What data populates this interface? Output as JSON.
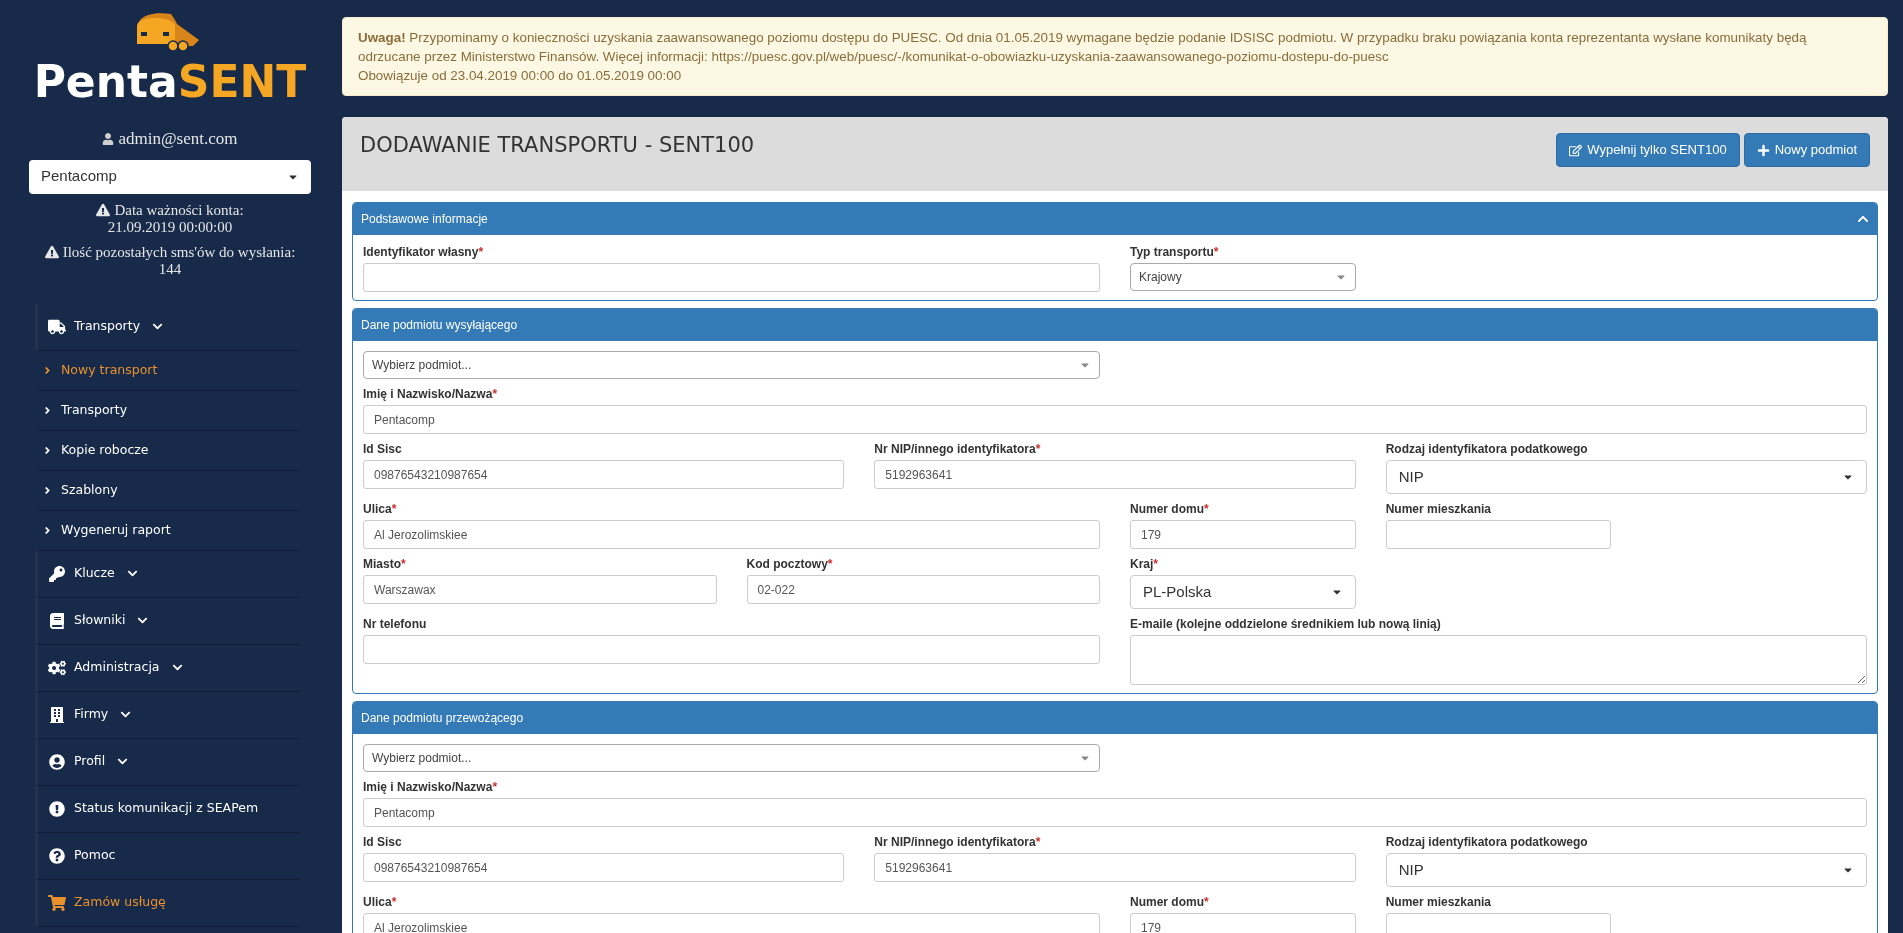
{
  "sidebar": {
    "logo": {
      "part_1": "Penta",
      "part_2": "SENT"
    },
    "user": "admin@sent.com",
    "company_select": {
      "value": "Pentacomp"
    },
    "notices": [
      {
        "label": "Data ważności konta:",
        "value": "21.09.2019 00:00:00"
      },
      {
        "label": "Ilość pozostałych sms'ów do wysłania:",
        "value": "144"
      }
    ],
    "menu": [
      {
        "kind": "group",
        "label": "Transporty",
        "children": [
          {
            "label": "Nowy transport",
            "selected": true
          },
          {
            "label": "Transporty",
            "selected": false
          },
          {
            "label": "Kopie robocze",
            "selected": false
          },
          {
            "label": "Szablony",
            "selected": false
          },
          {
            "label": "Wygeneruj raport",
            "selected": false
          }
        ]
      },
      {
        "kind": "group",
        "label": "Klucze"
      },
      {
        "kind": "group",
        "label": "Słowniki"
      },
      {
        "kind": "group",
        "label": "Administracja"
      },
      {
        "kind": "group",
        "label": "Firmy"
      },
      {
        "kind": "group",
        "label": "Profil"
      },
      {
        "kind": "link",
        "label": "Status komunikacji z SEAPem"
      },
      {
        "kind": "link",
        "label": "Pomoc"
      },
      {
        "kind": "promo",
        "label": "Zamów usługę"
      }
    ]
  },
  "alert": {
    "message": "**Uwaga!** Przypominamy o konieczności uzyskania zaawansowanego poziomu dostępu do PUESC. Od dnia 01.05.2019 wymagane będzie podanie IDSISC podmiotu. W przypadku braku powiązania konta reprezentanta wysłane komunikaty będą odrzucane przez Ministerstwo Finansów. Więcej informacji: https://puesc.gov.pl/web/puesc/-/komunikat-o-obowiazku-uzyskania-zaawansowanego-poziomu-dostepu-do-puesc",
    "validity": "Obowiązuje od 23.04.2019 00:00 do 01.05.2019 00:00"
  },
  "page": {
    "title": "DODAWANIE TRANSPORTU - SENT100",
    "buttons": [
      "Wypełnij tylko SENT100",
      "Nowy podmiot"
    ]
  },
  "sections": [
    {
      "title": "Podstawowe informacje",
      "collapsible": true,
      "fields": [
        {
          "kind": "input",
          "label": "Identyfikator własny",
          "required_mark": "*"
        },
        {
          "kind": "select",
          "label": "Typ transportu",
          "required_mark": "*",
          "value": "Krajowy"
        }
      ]
    },
    {
      "title": "Dane podmiotu wysyłającego",
      "collapsible": false,
      "fields": [
        {
          "kind": "select",
          "placeholder": "Wybierz podmiot..."
        },
        {
          "kind": "input",
          "label": "Imię i Nazwisko/Nazwa",
          "required_mark": "*",
          "value": "Pentacomp"
        },
        {
          "kind": "input",
          "label": "Id Sisc",
          "value": "09876543210987654"
        },
        {
          "kind": "input",
          "label": "Nr NIP/innego identyfikatora",
          "required_mark": "*",
          "value": "5192963641"
        },
        {
          "kind": "select-lg",
          "label": "Rodzaj identyfikatora podatkowego",
          "value": "NIP"
        },
        {
          "kind": "input",
          "label": "Ulica",
          "required_mark": "*",
          "value": "Al Jerozolimskiee"
        },
        {
          "kind": "input",
          "label": "Numer domu",
          "required_mark": "*",
          "value": "179"
        },
        {
          "kind": "input",
          "label": "Numer mieszkania"
        },
        {
          "kind": "input",
          "label": "Miasto",
          "required_mark": "*",
          "value": "Warszawax"
        },
        {
          "kind": "input",
          "label": "Kod pocztowy",
          "required_mark": "*",
          "value": "02-022"
        },
        {
          "kind": "select-lg",
          "label": "Kraj",
          "required_mark": "*",
          "value": "PL-Polska"
        },
        {
          "kind": "input",
          "label": "Nr telefonu"
        },
        {
          "kind": "textarea",
          "label": "E-maile (kolejne oddzielone średnikiem lub nową linią)"
        }
      ]
    },
    {
      "title": "Dane podmiotu przewożącego",
      "collapsible": false,
      "fields": [
        {
          "kind": "select",
          "placeholder": "Wybierz podmiot..."
        },
        {
          "kind": "input",
          "label": "Imię i Nazwisko/Nazwa",
          "required_mark": "*",
          "value": "Pentacomp"
        },
        {
          "kind": "input",
          "label": "Id Sisc",
          "value": "09876543210987654"
        },
        {
          "kind": "input",
          "label": "Nr NIP/innego identyfikatora",
          "required_mark": "*",
          "value": "5192963641"
        },
        {
          "kind": "select-lg",
          "label": "Rodzaj identyfikatora podatkowego",
          "value": "NIP"
        },
        {
          "kind": "input",
          "label": "Ulica",
          "required_mark": "*",
          "value": "Al Jerozolimskiee"
        },
        {
          "kind": "input",
          "label": "Numer domu",
          "required_mark": "*",
          "value": "179"
        },
        {
          "kind": "input",
          "label": "Numer mieszkania"
        }
      ]
    }
  ]
}
